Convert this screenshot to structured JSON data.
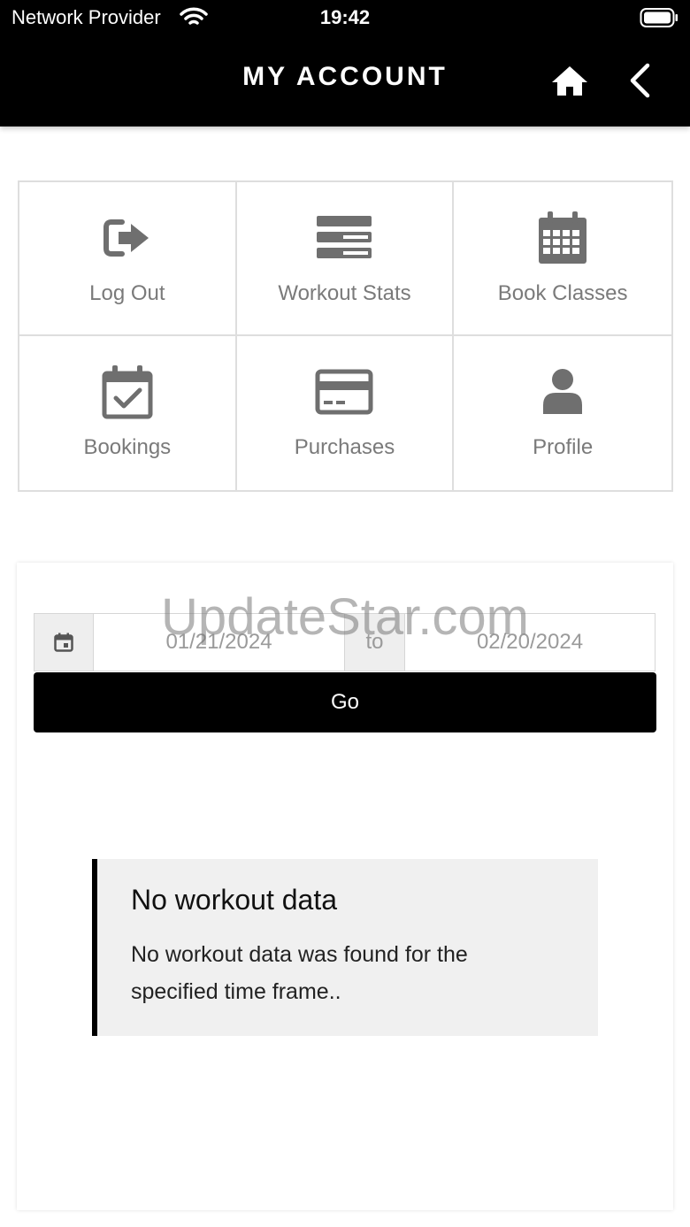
{
  "status_bar": {
    "provider": "Network Provider",
    "time": "19:42"
  },
  "header": {
    "title": "MY ACCOUNT"
  },
  "menu": {
    "items": [
      {
        "label": "Log Out",
        "icon": "logout-icon"
      },
      {
        "label": "Workout Stats",
        "icon": "stats-icon"
      },
      {
        "label": "Book Classes",
        "icon": "calendar-icon"
      },
      {
        "label": "Bookings",
        "icon": "calendar-check-icon"
      },
      {
        "label": "Purchases",
        "icon": "credit-card-icon"
      },
      {
        "label": "Profile",
        "icon": "user-icon"
      }
    ]
  },
  "date_range": {
    "from": "01/21/2024",
    "separator": "to",
    "to": "02/20/2024",
    "go_label": "Go"
  },
  "alert": {
    "title": "No workout data",
    "message": "No workout data was found for the specified time frame.."
  },
  "watermark": "UpdateStar.com",
  "colors": {
    "header_bg": "#000000",
    "icon_gray": "#6f6f6f",
    "label_gray": "#7a7a7a",
    "alert_bg": "#f0f0f0"
  }
}
